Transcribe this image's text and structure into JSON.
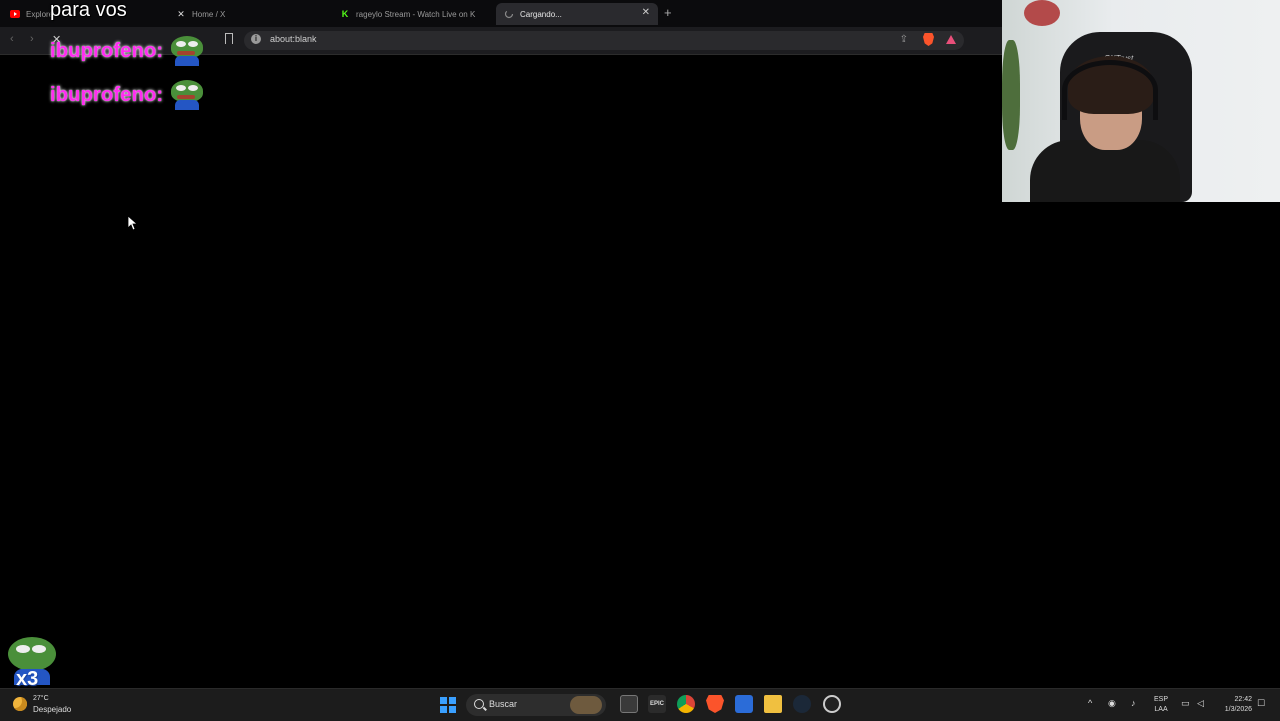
{
  "browser": {
    "tabs": [
      {
        "label": "Explore",
        "icon": "youtube-icon",
        "active": false
      },
      {
        "label": "Home / X",
        "icon": "x-logo-icon",
        "active": false
      },
      {
        "label": "rageylo Stream - Watch Live on K",
        "icon": "kick-logo-icon",
        "active": false
      },
      {
        "label": "Cargando...",
        "icon": "loading-spinner-icon",
        "active": true
      }
    ],
    "url": "about:blank",
    "colors": {
      "accent": "#fb542b",
      "tab_active_bg": "#2a2a2e"
    }
  },
  "overlay": {
    "title": "para vos",
    "chat": [
      {
        "name": "ibuprofeno:",
        "emote": "pepe-emote-icon"
      },
      {
        "name": "ibuprofeno:",
        "emote": "pepe-emote-icon"
      }
    ],
    "combo_count": "x3",
    "webcam_label": "GXTrust"
  },
  "taskbar": {
    "weather_temp": "27°C",
    "weather_desc": "Despejado",
    "search_placeholder": "Buscar",
    "lang_line1": "ESP",
    "lang_line2": "LAA",
    "time": "22:42",
    "date": "1/3/2026",
    "apps": [
      "start-icon",
      "search-icon",
      "task-view-icon",
      "epic-games-icon",
      "chrome-icon",
      "brave-icon",
      "microsoft-store-icon",
      "file-explorer-icon",
      "steam-icon",
      "obs-icon"
    ]
  }
}
